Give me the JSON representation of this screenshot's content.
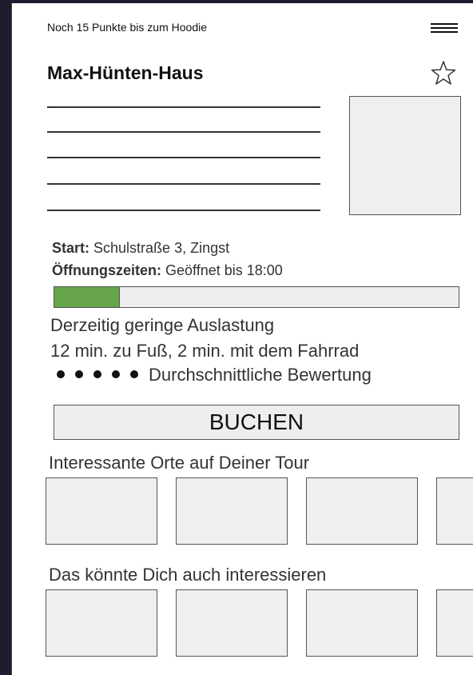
{
  "header": {
    "promo_text": "Noch 15 Punkte bis zum Hoodie",
    "menu_icon": "hamburger-menu-icon"
  },
  "place": {
    "title": "Max-Hünten-Haus",
    "favorite_icon": "star-outline-icon",
    "start_label": "Start:",
    "start_value": "Schulstraße 3, Zingst",
    "hours_label": "Öffnungszeiten:",
    "hours_value": "Geöffnet bis 18:00",
    "occupancy_fraction": 0.16,
    "occupancy_color": "#67a54b",
    "occupancy_text": "Derzeitig geringe Auslastung",
    "travel_text": "12 min. zu Fuß, 2 min. mit dem Fahrrad",
    "rating_dots": 5,
    "rating_text": "Durchschnittliche Bewertung"
  },
  "actions": {
    "book_label": "BUCHEN"
  },
  "sections": {
    "tour_heading": "Interessante Orte auf Deiner Tour",
    "tour_tile_count": 4,
    "recommend_heading": "Das könnte Dich auch interessieren",
    "recommend_tile_count": 4
  }
}
